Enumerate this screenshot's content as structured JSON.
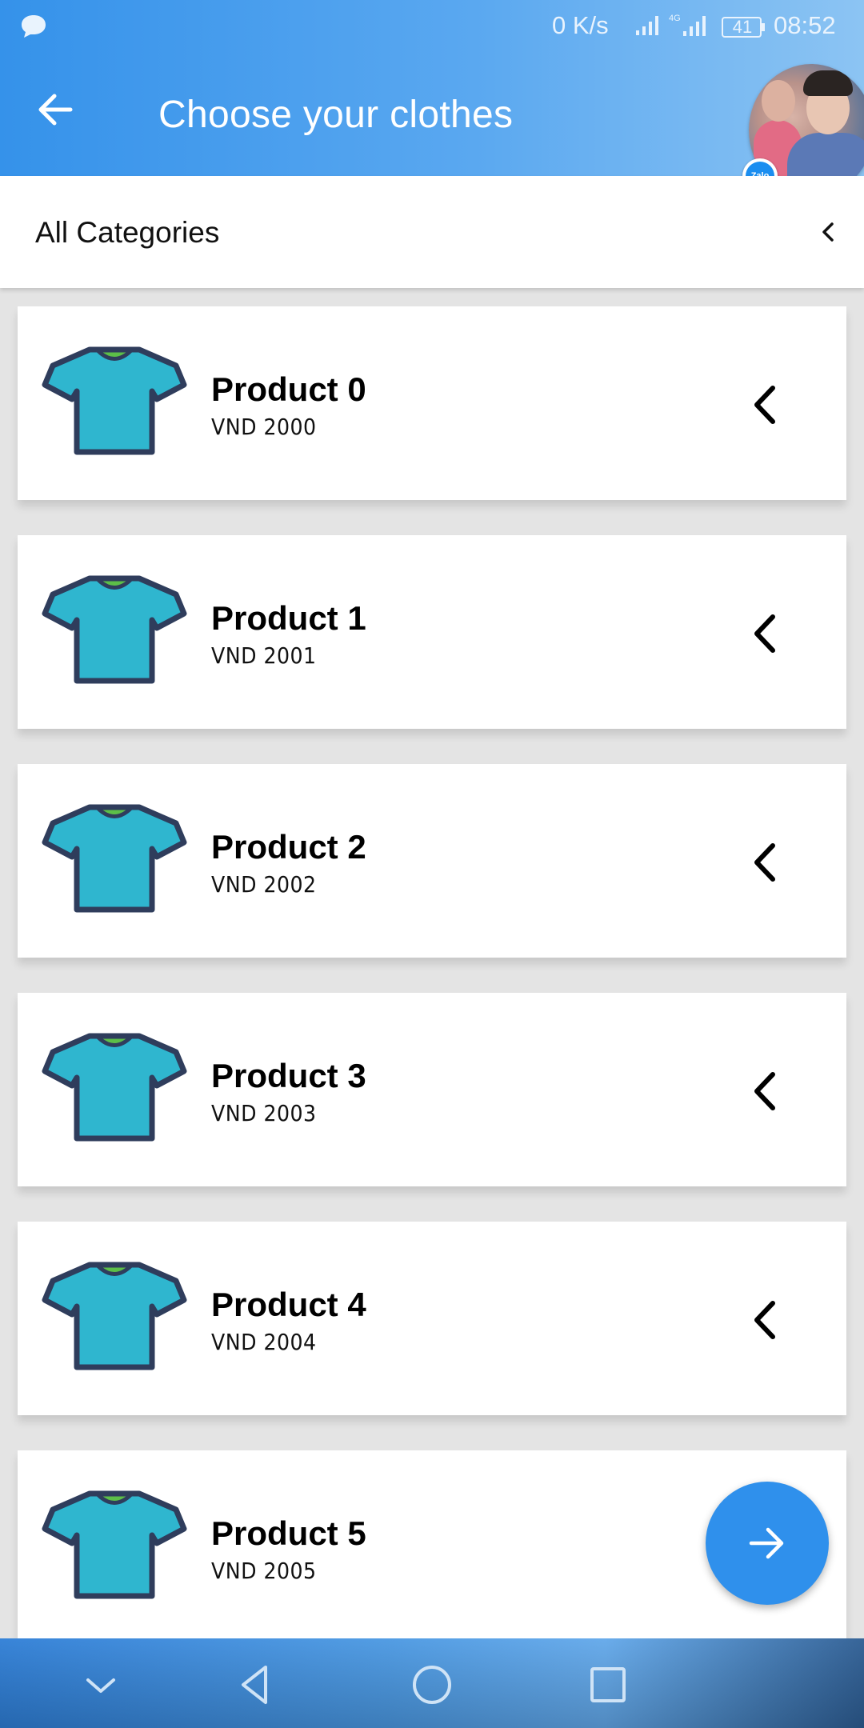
{
  "status_bar": {
    "network_speed": "0 K/s",
    "battery": "41",
    "time": "08:52",
    "icons": [
      "chat-bubble-icon",
      "signal-icon",
      "4g-signal-icon",
      "battery-icon"
    ]
  },
  "header": {
    "title": "Choose your clothes",
    "back_icon": "arrow-left-icon",
    "zalo_badge": "Zalo"
  },
  "category": {
    "label": "All Categories",
    "icon": "chevron-left-icon"
  },
  "products": [
    {
      "name": "Product 0",
      "price": "VND 2000"
    },
    {
      "name": "Product 1",
      "price": "VND 2001"
    },
    {
      "name": "Product 2",
      "price": "VND 2002"
    },
    {
      "name": "Product 3",
      "price": "VND 2003"
    },
    {
      "name": "Product 4",
      "price": "VND 2004"
    },
    {
      "name": "Product 5",
      "price": "VND 2005"
    }
  ],
  "fab": {
    "icon": "arrow-right-icon"
  },
  "navigation": {
    "icons": [
      "chevron-down-icon",
      "back-triangle-icon",
      "home-circle-icon",
      "recents-square-icon"
    ]
  },
  "colors": {
    "header_start": "#3592ea",
    "header_end": "#8cc4f3",
    "fab": "#2f90ec",
    "shirt": "#2fb6cf",
    "shirt_outline": "#2f3d5c",
    "collar": "#5cbf48"
  }
}
